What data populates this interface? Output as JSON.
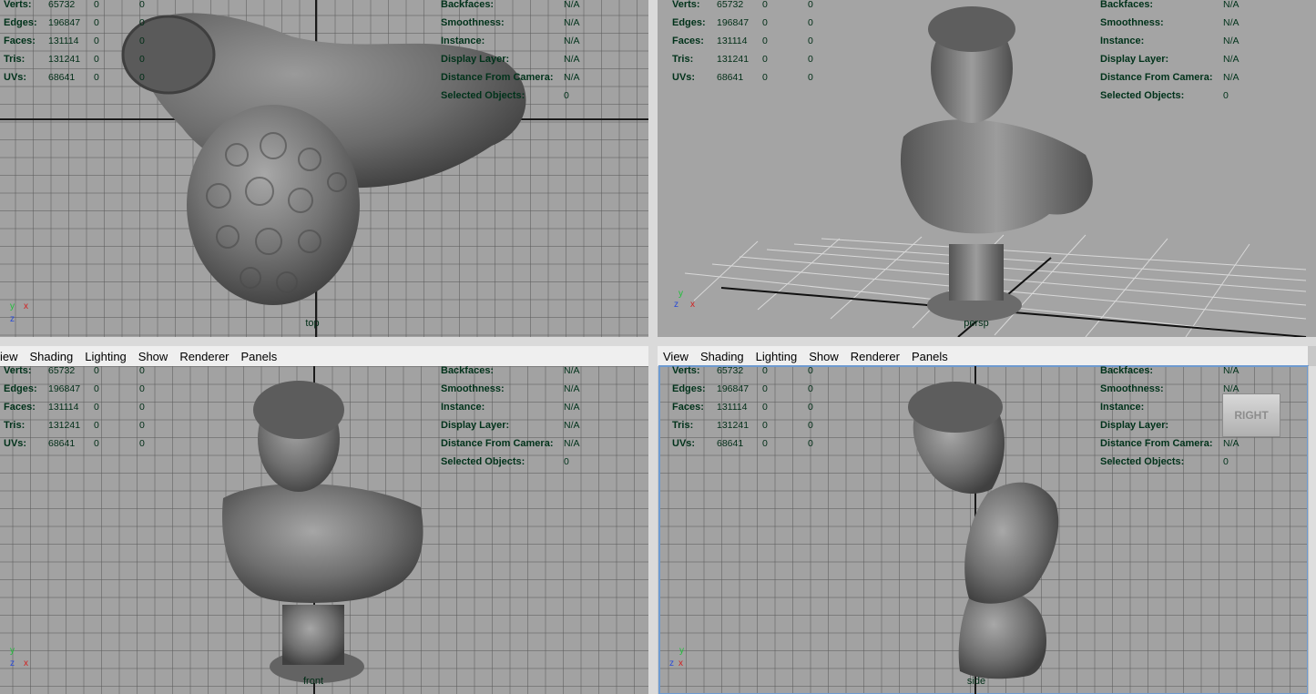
{
  "menu": [
    "iew",
    "Shading",
    "Lighting",
    "Show",
    "Renderer",
    "Panels"
  ],
  "menu_right": [
    "View",
    "Shading",
    "Lighting",
    "Show",
    "Renderer",
    "Panels"
  ],
  "hud": {
    "stats": [
      {
        "label": "Verts:",
        "v1": "65732",
        "v2": "0",
        "v3": "0"
      },
      {
        "label": "Edges:",
        "v1": "196847",
        "v2": "0",
        "v3": "0"
      },
      {
        "label": "Faces:",
        "v1": "131114",
        "v2": "0",
        "v3": "0"
      },
      {
        "label": "Tris:",
        "v1": "131241",
        "v2": "0",
        "v3": "0"
      },
      {
        "label": "UVs:",
        "v1": "68641",
        "v2": "0",
        "v3": "0"
      }
    ],
    "info": [
      {
        "label": "Backfaces:",
        "value": "N/A"
      },
      {
        "label": "Smoothness:",
        "value": "N/A"
      },
      {
        "label": "Instance:",
        "value": "N/A"
      },
      {
        "label": "Display Layer:",
        "value": "N/A"
      },
      {
        "label": "Distance From Camera:",
        "value": "N/A"
      },
      {
        "label": "Selected Objects:",
        "value": "0"
      }
    ]
  },
  "cameras": {
    "top": "top",
    "persp": "persp",
    "front": "front",
    "side": "side"
  },
  "view_cube": "RIGHT",
  "gizmo": {
    "x": "x",
    "y": "y",
    "z": "z"
  },
  "colors": {
    "viewport_bg": "#a2a2a2",
    "hud_text": "#00321a",
    "axis_x": "#d22020",
    "axis_y": "#1fbf3a",
    "axis_z": "#2a4bd6",
    "model": "#6a6a6a"
  }
}
